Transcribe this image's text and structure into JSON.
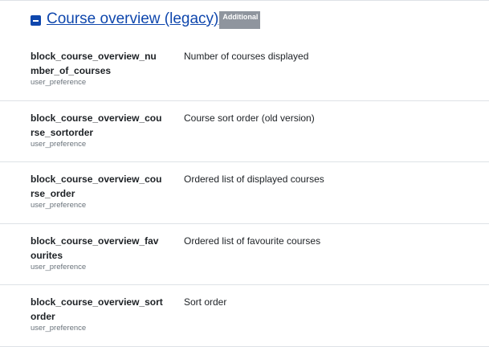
{
  "section": {
    "title": "Course overview (legacy)",
    "badge": "Additional"
  },
  "rows": [
    {
      "name_line1": "block_course_overview_nu",
      "name_line2": "mber_of_courses",
      "type": "user_preference",
      "description": "Number of courses displayed"
    },
    {
      "name_line1": "block_course_overview_cou",
      "name_line2": "rse_sortorder",
      "type": "user_preference",
      "description": "Course sort order (old version)"
    },
    {
      "name_line1": "block_course_overview_cou",
      "name_line2": "rse_order",
      "type": "user_preference",
      "description": "Ordered list of displayed courses"
    },
    {
      "name_line1": "block_course_overview_fav",
      "name_line2": "ourites",
      "type": "user_preference",
      "description": "Ordered list of favourite courses"
    },
    {
      "name_line1": "block_course_overview_sort",
      "name_line2": "order",
      "type": "user_preference",
      "description": "Sort order"
    }
  ]
}
